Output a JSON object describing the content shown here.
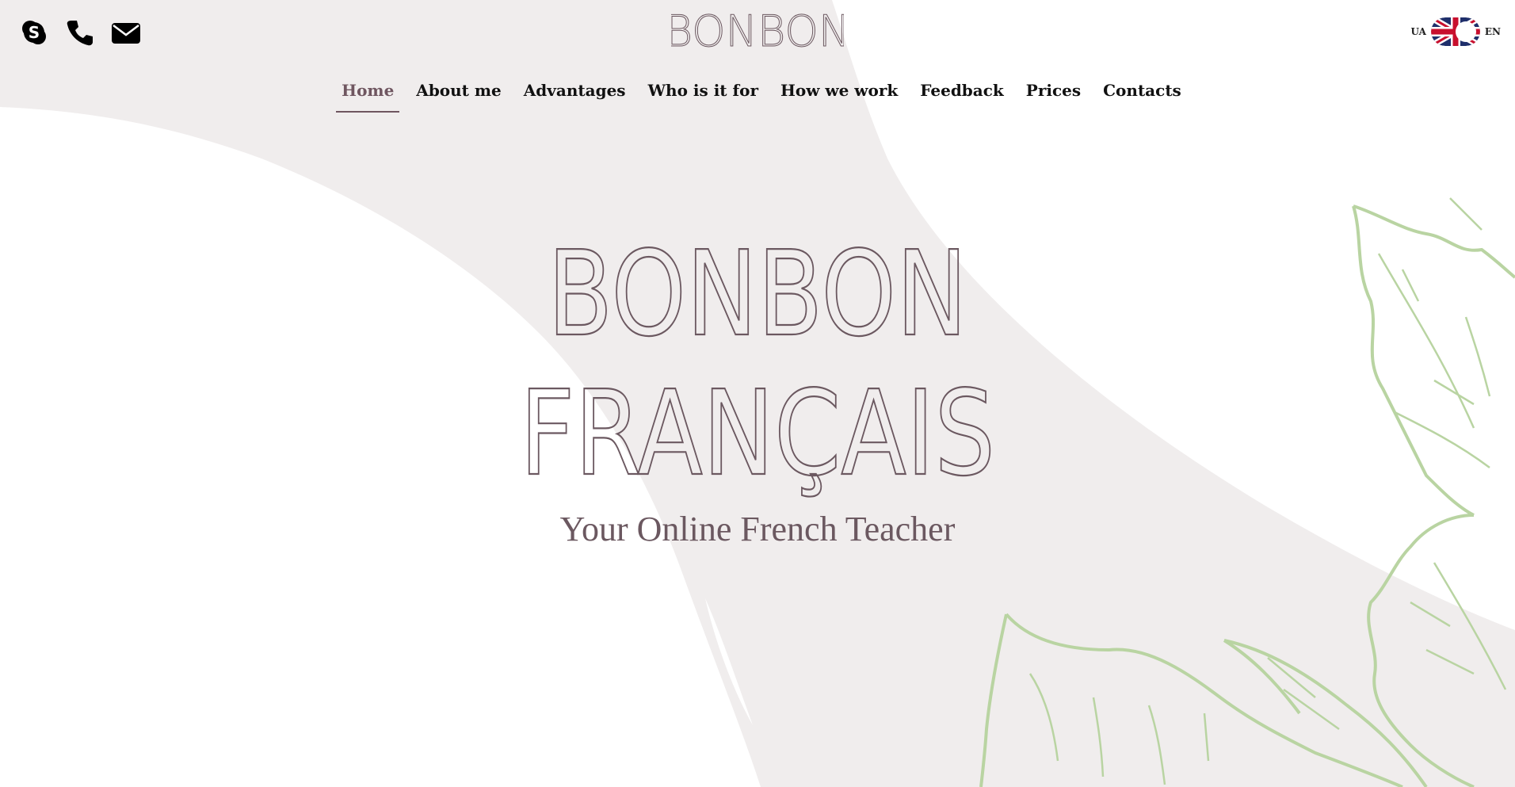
{
  "header": {
    "logo": "BONBON",
    "contact_icons": [
      "skype-icon",
      "phone-icon",
      "envelope-icon"
    ],
    "lang": {
      "left": "UA",
      "right": "EN",
      "flag": "uk-flag-icon"
    }
  },
  "nav": {
    "items": [
      {
        "label": "Home",
        "active": true
      },
      {
        "label": "About me",
        "active": false
      },
      {
        "label": "Advantages",
        "active": false
      },
      {
        "label": "Who is it for",
        "active": false
      },
      {
        "label": "How we work",
        "active": false
      },
      {
        "label": "Feedback",
        "active": false
      },
      {
        "label": "Prices",
        "active": false
      },
      {
        "label": "Contacts",
        "active": false
      }
    ]
  },
  "hero": {
    "line1": "BONBON",
    "line2": "FRANÇAIS",
    "tagline": "Your Online French Teacher"
  },
  "colors": {
    "accent": "#6f5660",
    "background_shape": "#f0eded",
    "leaf": "#b9d4a2"
  }
}
